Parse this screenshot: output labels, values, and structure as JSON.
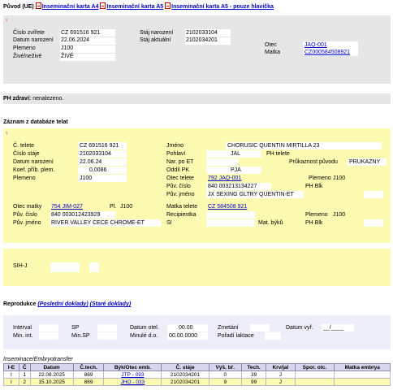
{
  "top": {
    "label": "Původ (UE)",
    "links": [
      "Inseminační karta A4",
      "Inseminační karta A5",
      "Inseminační karta A5 - pouze hlavička"
    ]
  },
  "puvod": {
    "cislo_zvirete_label": "Číslo zvířete",
    "cislo_zvirete": "CZ 691516 921",
    "datum_narozeni_label": "Datum narození",
    "datum_narozeni": "22.06.2024",
    "plemeno_label": "Plemeno",
    "plemeno": "J100",
    "zive_label": "Živé/neživé",
    "zive": "ŽIVÉ",
    "staj_narozeni_label": "Stáj narození",
    "staj_narozeni": "2102033104",
    "staj_aktualni_label": "Stáj aktuální",
    "staj_aktualni": "2102034201",
    "otec_label": "Otec",
    "otec": "JAQ-001",
    "matka_label": "Matka",
    "matka": "CZ000584508921"
  },
  "ph": {
    "label": "PH zdraví:",
    "value": "nenalezeno."
  },
  "zaznam": {
    "title": "Záznam z databáze telat",
    "c_telete_label": "Č. telete",
    "c_telete": "CZ 691516 921",
    "cislo_staje_label": "Číslo stáje",
    "cislo_staje": "2102033104",
    "datum_narozeni_label": "Datum narození",
    "datum_narozeni": "22.06.24",
    "koef_label": "Koef. příb. plem.",
    "koef": "0,0086",
    "plemeno_label": "Plemeno",
    "plemeno": "J100",
    "jmeno_label": "Jméno",
    "jmeno": "CHORUSIC QUENTIN MIRTILLA 23",
    "pohlavi_label": "Pohlaví",
    "pohlavi": "JAL",
    "ph_telete_label": "PH telete",
    "nar_po_et_label": "Nar. po ET",
    "prukaznost_label": "Průkaznost původu",
    "prukaznost": "PRUKAZNY",
    "oddil_pk_label": "Oddíl PK",
    "oddil_pk": "PJA",
    "otec_telete_label": "Otec telete",
    "otec_telete": "792 JAQ-001",
    "otec_plemeno_label": "Plemeno",
    "otec_plemeno": "J100",
    "puv_cislo_label": "Pův. číslo",
    "puv_cislo": "840 003213134227",
    "ph_blk_label": "PH Blk",
    "puv_jmeno_label": "Pův. jméno",
    "puv_jmeno": "JX SEXING GLTRY QUENTIN-ET",
    "otec_matky_label": "Otec matky",
    "otec_matky": "754 JIM-027",
    "pl_label": "Pl.",
    "pl": "J100",
    "matka_telete_label": "Matka telete",
    "matka_telete": "CZ 584508 921",
    "puv_cislo2_label": "Pův. číslo",
    "puv_cislo2": "840 003012423929",
    "recipientka_label": "Recipientka",
    "plemeno3_label": "Plemeno",
    "plemeno3": "J100",
    "puv_jmeno2_label": "Pův. jméno",
    "puv_jmeno2": "RIVER VALLEY CECE CHROME-ET",
    "si_label": "SI",
    "mat_byku_label": "Mat. býků",
    "ph_blk2_label": "PH Blk",
    "sih_label": "SIH-J"
  },
  "reprodukce": {
    "title": "Reprodukce",
    "link1": "(Poslední doklady)",
    "link2": "(Staré doklady)",
    "interval_label": "Interval",
    "min_int_label": "Min. int.",
    "sp_label": "SP",
    "min_sp_label": "Min.SP",
    "datum_otel_label": "Datum otel.",
    "datum_otel": "00.00",
    "minule_do_label": "Minulé d.o.",
    "minule_do": "00.00.0000",
    "zmetani_label": "Zmetání",
    "poradi_label": "Pořadí laktace",
    "datum_vyr_label": "Datum vyř.",
    "datum_vyr": "__/____"
  },
  "inseminace": {
    "title": "Inseminace/Embryotransfer",
    "columns": [
      "I-E",
      "Č",
      "Datum",
      "Č.tech.",
      "Býk/Otec emb.",
      "Č. stáje",
      "Výš. bř.",
      "Tech.",
      "Krv/jal",
      "Spor. otc.",
      "Matka embrya"
    ],
    "rows": [
      [
        "I",
        "1",
        "22.08.2025",
        "869",
        "JTP - 093",
        "2102034201",
        "0",
        "39",
        "J",
        "",
        ""
      ],
      [
        "I",
        "2",
        "15.10.2025",
        "869",
        "JHO - 033",
        "2102034201",
        "9",
        "99",
        "J",
        "",
        ""
      ]
    ]
  },
  "colors": {
    "grey_panel": "#e6e6e6",
    "yellow_panel": "#fdfab1",
    "lavender_panel": "#eeeefa",
    "link": "#0000cc"
  }
}
